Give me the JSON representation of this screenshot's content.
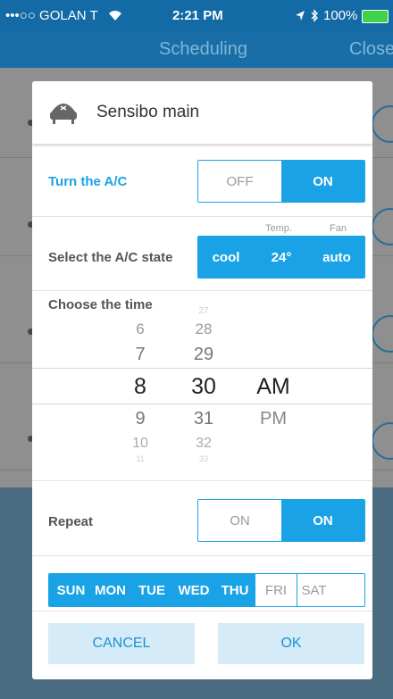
{
  "status_bar": {
    "carrier": "•••○○ GOLAN T",
    "time": "2:21 PM",
    "battery": "100%"
  },
  "nav": {
    "title": "Scheduling",
    "close": "Close"
  },
  "dialog": {
    "title": "Sensibo main",
    "turn_label": "Turn the A/C",
    "turn_off": "OFF",
    "turn_on": "ON",
    "state_label": "Select the A/C state",
    "temp_caption": "Temp.",
    "fan_caption": "Fan",
    "mode": "cool",
    "temp": "24°",
    "fan": "auto",
    "time_label": "Choose the time",
    "hours": [
      "6",
      "7",
      "8",
      "9",
      "10",
      "11"
    ],
    "minutes": [
      "27",
      "28",
      "29",
      "30",
      "31",
      "32",
      "33"
    ],
    "ampm": [
      "AM",
      "PM"
    ],
    "repeat_label": "Repeat",
    "repeat_off": "ON",
    "repeat_on": "ON",
    "days": [
      {
        "label": "SUN",
        "selected": true
      },
      {
        "label": "MON",
        "selected": true
      },
      {
        "label": "TUE",
        "selected": true
      },
      {
        "label": "WED",
        "selected": true
      },
      {
        "label": "THU",
        "selected": true
      },
      {
        "label": "FRI",
        "selected": false
      },
      {
        "label": "SAT",
        "selected": false
      }
    ],
    "cancel": "CANCEL",
    "ok": "OK"
  },
  "colors": {
    "accent": "#1aa2e6",
    "nav": "#1a6ea7",
    "button_bg": "#d5ebf7"
  }
}
